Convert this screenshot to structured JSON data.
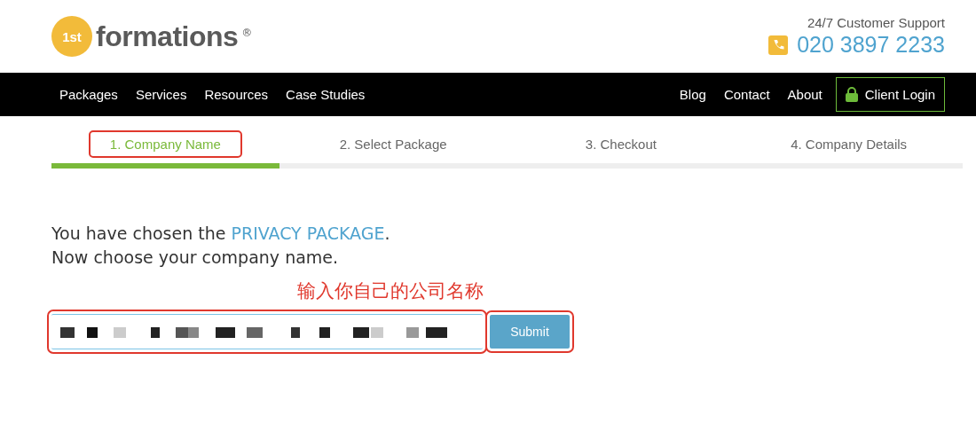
{
  "logo": {
    "badge": "1st",
    "name": "formations",
    "mark": "®"
  },
  "support": {
    "label": "24/7 Customer Support",
    "phone": "020 3897 2233"
  },
  "nav": {
    "left": [
      "Packages",
      "Services",
      "Resources",
      "Case Studies"
    ],
    "right": [
      "Blog",
      "Contact",
      "About"
    ],
    "login": "Client Login"
  },
  "steps": [
    {
      "label": "1. Company Name",
      "selected": true,
      "highlighted": true
    },
    {
      "label": "2. Select Package",
      "selected": false,
      "highlighted": false
    },
    {
      "label": "3. Checkout",
      "selected": false,
      "highlighted": false
    },
    {
      "label": "4. Company Details",
      "selected": false,
      "highlighted": false
    }
  ],
  "intro": {
    "before": "You have chosen the",
    "link": "PRIVACY PACKAGE",
    "after": "."
  },
  "prompt": "Now choose your company name.",
  "annotation": "输入你自己的公司名称",
  "name_field": {
    "highlighted": true
  },
  "submit": {
    "label": "Submit",
    "highlighted": true
  }
}
